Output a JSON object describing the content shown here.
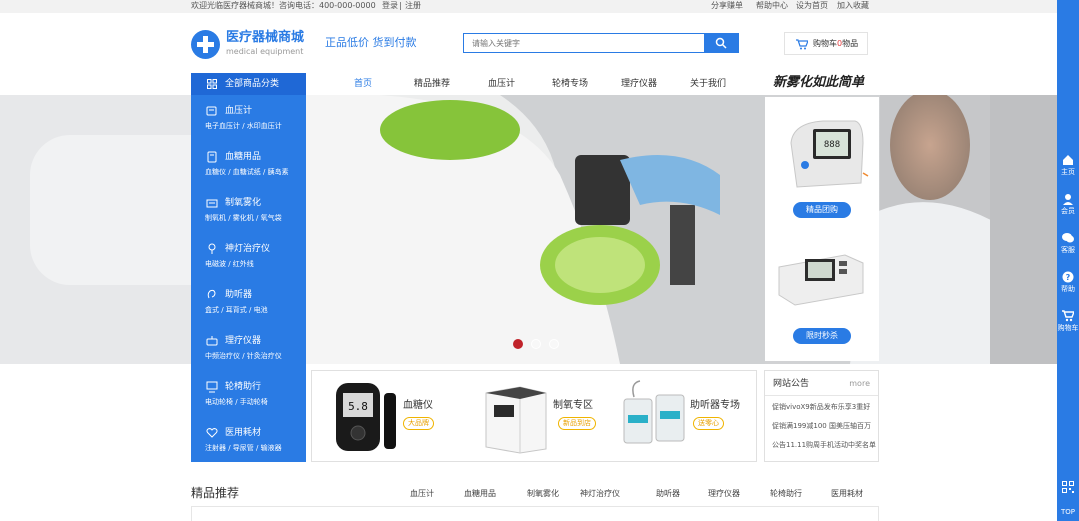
{
  "topbar": {
    "welcome": "欢迎光临医疗器械商城！咨询电话：400-000-0000",
    "login": "登录",
    "sep": "|",
    "register": "注册",
    "links": [
      "分享赚单",
      "帮助中心",
      "设为首页",
      "加入收藏"
    ]
  },
  "logo": {
    "title": "医疗器械商城",
    "subtitle": "medical equipment"
  },
  "slogan": "正品低价 货到付款",
  "search": {
    "placeholder": "请输入关键字",
    "icon": "search-icon"
  },
  "cart": {
    "label": "购物车",
    "count": "0",
    "unit": "物品"
  },
  "categories": {
    "title": "全部商品分类",
    "items": [
      {
        "name": "血压计",
        "sub": "电子血压计 / 水印血压计"
      },
      {
        "name": "血糖用品",
        "sub": "血糖仪 / 血糖试纸 / 胰岛素"
      },
      {
        "name": "制氧雾化",
        "sub": "制氧机 / 雾化机 / 氧气袋"
      },
      {
        "name": "神灯治疗仪",
        "sub": "电磁波 / 红外线"
      },
      {
        "name": "助听器",
        "sub": "盒式 / 耳背式 / 电池"
      },
      {
        "name": "理疗仪器",
        "sub": "中频治疗仪 / 针灸治疗仪"
      },
      {
        "name": "轮椅助行",
        "sub": "电动轮椅 / 手动轮椅"
      },
      {
        "name": "医用耗材",
        "sub": "注射器 / 导尿管 / 输液器"
      }
    ]
  },
  "nav": [
    "首页",
    "精品推荐",
    "血压计",
    "轮椅专场",
    "理疗仪器",
    "关于我们"
  ],
  "promo": "新雾化如此简单",
  "banner": {
    "slides": 3,
    "active": 1
  },
  "side_panel": {
    "buttons": [
      "精品团购",
      "限时秒杀"
    ]
  },
  "featured": [
    {
      "title": "血糖仪",
      "badge": "大品牌"
    },
    {
      "title": "制氧专区",
      "badge": "新品到店"
    },
    {
      "title": "助听器专场",
      "badge": "送零心"
    }
  ],
  "notice": {
    "title": "网站公告",
    "more": "more",
    "items": [
      "促销vivoX9新品发布乐享3重好",
      "促销满199减100 国美压轴百万",
      "公告11.11购周手机活动中奖名单"
    ]
  },
  "section": {
    "title": "精品推荐",
    "tabs": [
      "血压计",
      "血糖用品",
      "制氧雾化",
      "神灯治疗仪",
      "助听器",
      "理疗仪器",
      "轮椅助行",
      "医用耗材"
    ]
  },
  "right_rail": {
    "items": [
      {
        "label": "主页",
        "icon": "home-icon"
      },
      {
        "label": "会员",
        "icon": "user-icon"
      },
      {
        "label": "客服",
        "icon": "chat-icon"
      },
      {
        "label": "帮助",
        "icon": "help-icon"
      },
      {
        "label": "购物车",
        "icon": "cart-icon"
      }
    ],
    "top_label": "TOP"
  },
  "colors": {
    "accent": "#2a7be4",
    "accent_dark": "#1f68d6",
    "badge": "#f0b400",
    "dot_active": "#c0232a"
  }
}
